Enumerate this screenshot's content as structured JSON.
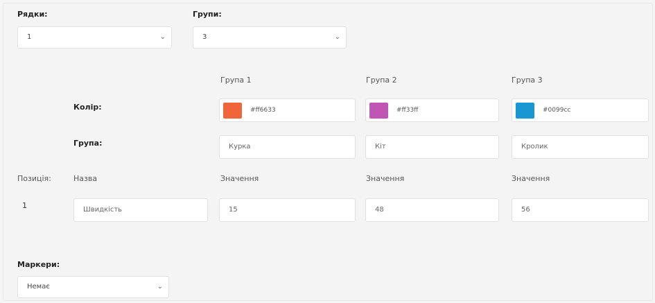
{
  "rows": {
    "label": "Рядки:",
    "value": "1"
  },
  "groups_count": {
    "label": "Групи:",
    "value": "3"
  },
  "groups": [
    {
      "header": "Група 1",
      "color": "#ff6633",
      "name": "Курка",
      "value": "15"
    },
    {
      "header": "Група 2",
      "color": "#ff33ff",
      "swatch": "#c055b5",
      "name": "Кіт",
      "value": "48"
    },
    {
      "header": "Група 3",
      "color": "#0099cc",
      "swatch": "#1997d2",
      "name": "Кролик",
      "value": "56"
    }
  ],
  "labels": {
    "color": "Колір:",
    "group": "Група:",
    "position": "Позиція:",
    "name": "Назва",
    "value": "Значення"
  },
  "row1": {
    "position": "1",
    "name": "Швидкість"
  },
  "markers": {
    "label": "Маркери:",
    "value": "Немає"
  },
  "colors": {
    "swatch1": "#f0663a",
    "chevron": "#666666"
  }
}
